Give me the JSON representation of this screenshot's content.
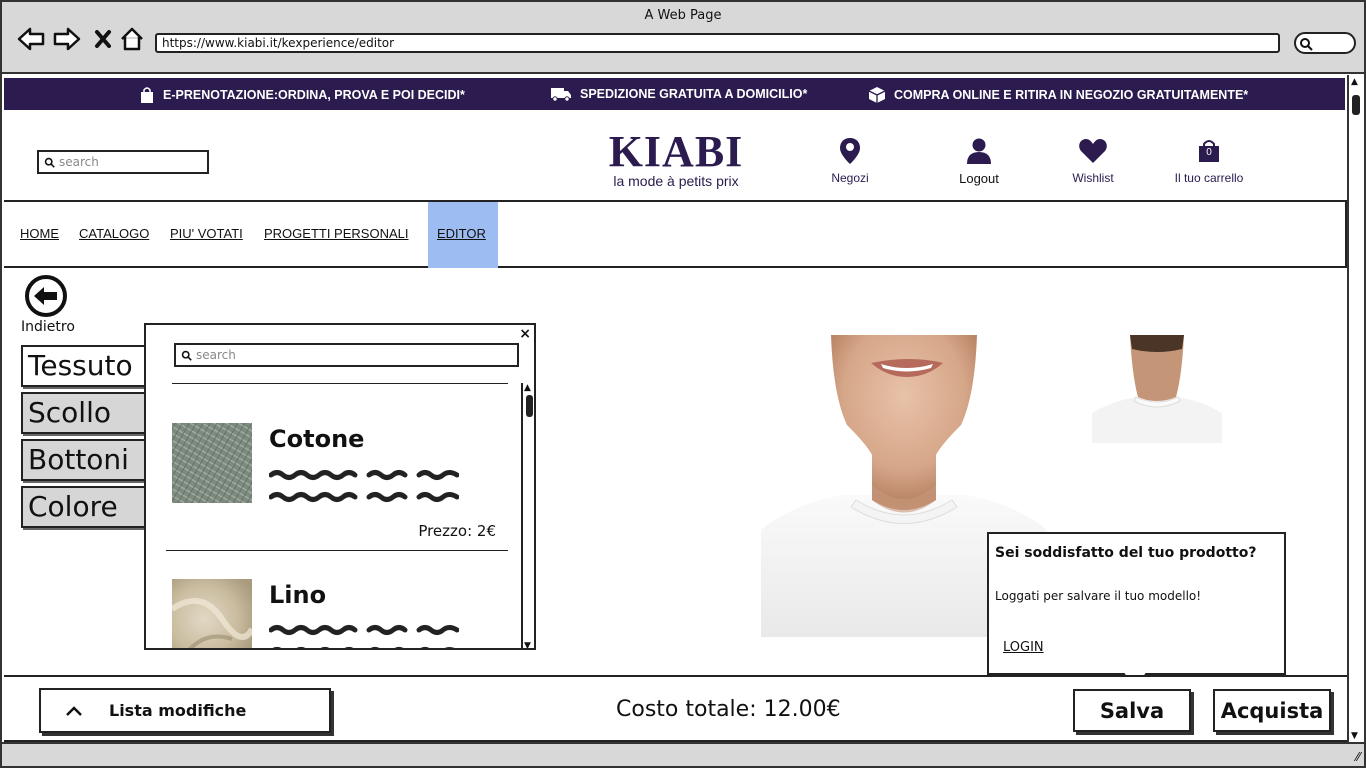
{
  "window": {
    "title": "A Web Page",
    "url": "https://www.kiabi.it/kexperience/editor"
  },
  "promo": {
    "items": [
      "E-PRENOTAZIONE:ORDINA, PROVA E POI DECIDI*",
      "SPEDIZIONE GRATUITA A DOMICILIO*",
      "COMPRA ONLINE E RITIRA IN NEGOZIO GRATUITAMENTE*"
    ]
  },
  "header": {
    "search_placeholder": "search",
    "brand": "KIABI",
    "tagline": "la mode à petits prix",
    "links": {
      "stores": "Negozi",
      "logout": "Logout",
      "wishlist": "Wishlist",
      "cart": "Il tuo carrello"
    },
    "cart_count": "0"
  },
  "nav": {
    "items": [
      "HOME",
      "CATALOGO",
      "PIU' VOTATI",
      "PROGETTI PERSONALI",
      "EDITOR"
    ],
    "active": "EDITOR"
  },
  "editor": {
    "back_label": "Indietro",
    "options": [
      "Tessuto",
      "Scollo",
      "Bottoni",
      "Colore"
    ],
    "active_option": "Tessuto"
  },
  "fabric_popup": {
    "close_label": "×",
    "search_placeholder": "search",
    "items": [
      {
        "name": "Cotone",
        "price": "Prezzo: 2€"
      },
      {
        "name": "Lino",
        "price": ""
      }
    ]
  },
  "tooltip": {
    "title": "Sei soddisfatto del tuo prodotto?",
    "message": "Loggati per salvare il tuo modello!",
    "link": "LOGIN"
  },
  "footer": {
    "list_label": "Lista modifiche",
    "total": "Costo totale: 12.00€",
    "save_label": "Salva",
    "buy_label": "Acquista"
  },
  "colors": {
    "brand": "#2b1b4e",
    "active_nav": "#9dbdf2",
    "chrome": "#d8d8d8"
  }
}
